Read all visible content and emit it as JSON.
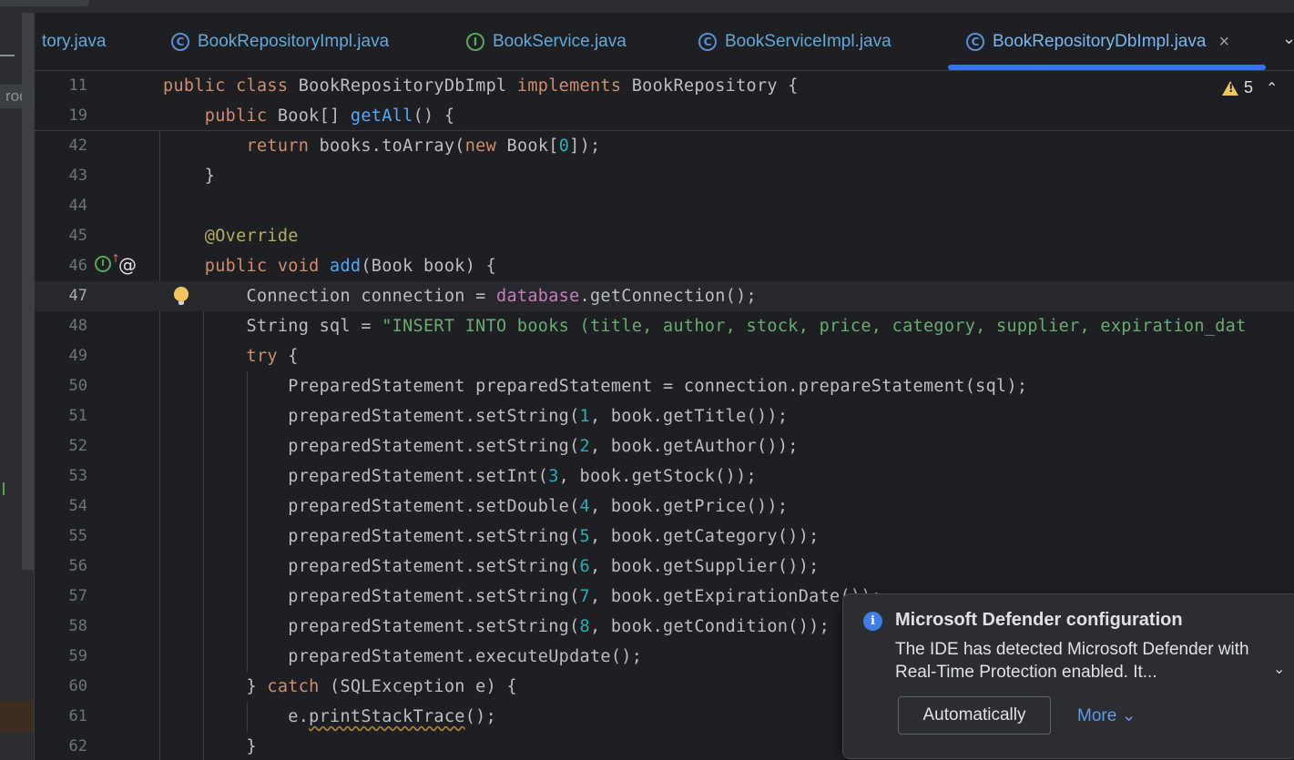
{
  "sidebar": {
    "root_label": "roo"
  },
  "tabs": [
    {
      "name": "tory.java",
      "icon": "",
      "active": false
    },
    {
      "name": "BookRepositoryImpl.java",
      "icon": "C",
      "active": false
    },
    {
      "name": "BookService.java",
      "icon": "I",
      "active": false
    },
    {
      "name": "BookServiceImpl.java",
      "icon": "C",
      "active": false
    },
    {
      "name": "BookRepositoryDbImpl.java",
      "icon": "C",
      "active": true
    }
  ],
  "tab_close": "×",
  "tab_more": "⌄",
  "editor": {
    "warnings_count": "5",
    "line_numbers": [
      "11",
      "19",
      "42",
      "43",
      "44",
      "45",
      "46",
      "47",
      "48",
      "49",
      "50",
      "51",
      "52",
      "53",
      "54",
      "55",
      "56",
      "57",
      "58",
      "59",
      "60",
      "61",
      "62"
    ],
    "current_line": "47"
  },
  "notification": {
    "title": "Microsoft Defender configuration",
    "body": "The IDE has detected Microsoft Defender with Real-Time Protection enabled. It...",
    "primary_button": "Automatically",
    "more_link": "More"
  },
  "colors": {
    "accent": "#3574f0",
    "keyword": "#cf8e6d",
    "function": "#56a8f5",
    "string": "#6aab73",
    "number": "#2aacb8",
    "annotation": "#b3ae60"
  }
}
